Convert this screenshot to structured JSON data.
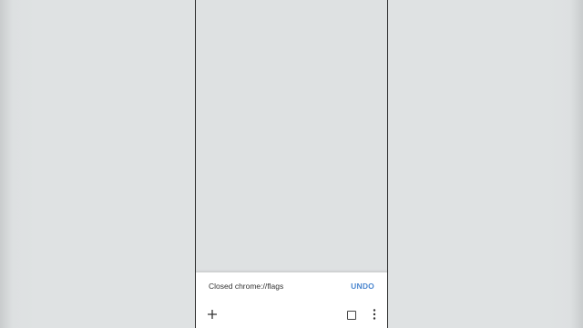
{
  "snackbar": {
    "message": "Closed chrome://flags",
    "action_label": "UNDO",
    "action_color": "#4a86cf"
  },
  "toolbar": {
    "new_tab_icon": "plus-icon",
    "tab_switcher_icon": "square-outline-icon",
    "menu_icon": "vertical-ellipsis-icon"
  }
}
